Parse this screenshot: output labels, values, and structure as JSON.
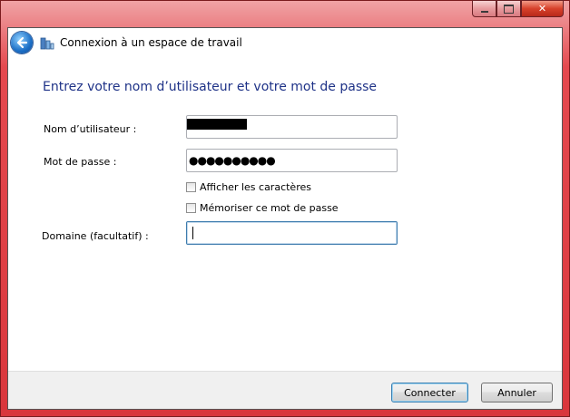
{
  "window": {
    "title": "Connexion à un espace de travail",
    "controls": {
      "minimize": "minimize-icon",
      "maximize": "maximize-icon",
      "close": "close-icon"
    }
  },
  "form": {
    "heading": "Entrez votre nom d’utilisateur et votre mot de passe",
    "username_label": "Nom d’utilisateur :",
    "username_value": "",
    "password_label": "Mot de passe :",
    "password_value": "●●●●●●●●●●",
    "show_chars_label": "Afficher les caractères",
    "remember_label": "Mémoriser ce mot de passe",
    "domain_label": "Domaine (facultatif) :",
    "domain_value": ""
  },
  "buttons": {
    "connect": "Connecter",
    "cancel": "Annuler"
  }
}
